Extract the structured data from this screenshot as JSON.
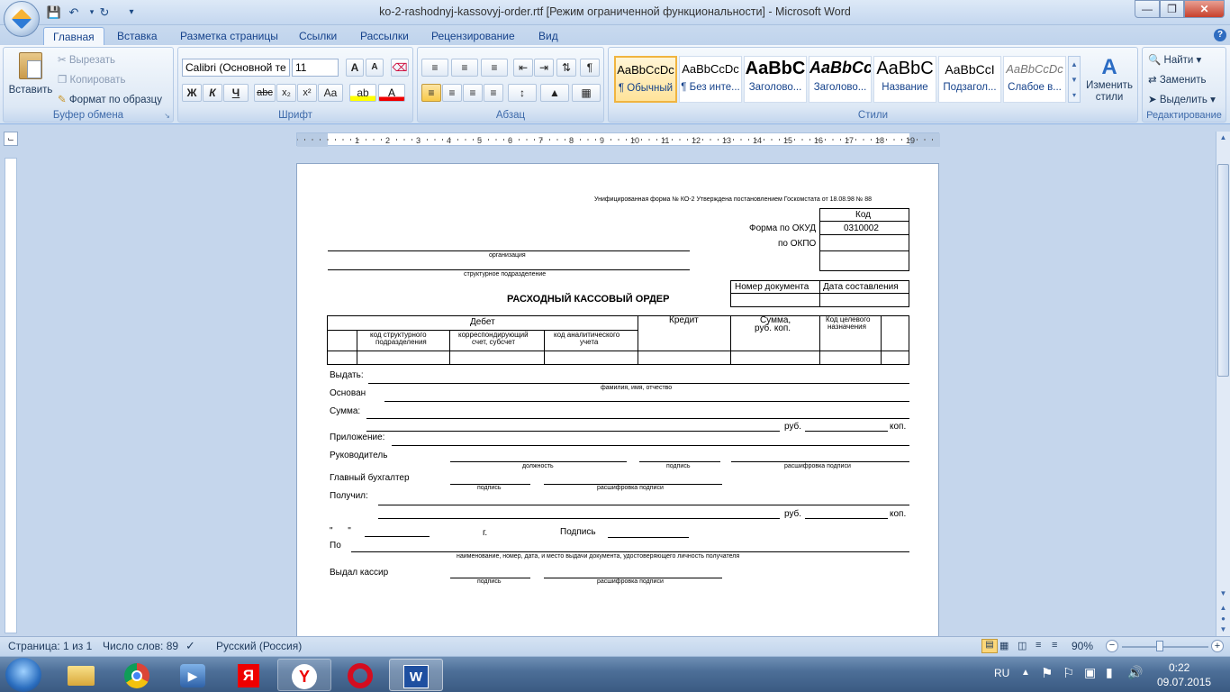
{
  "window": {
    "title": "ko-2-rashodnyj-kassovyj-order.rtf [Режим ограниченной функциональности] - Microsoft Word"
  },
  "tabs": [
    "Главная",
    "Вставка",
    "Разметка страницы",
    "Ссылки",
    "Рассылки",
    "Рецензирование",
    "Вид"
  ],
  "clipboard": {
    "paste": "Вставить",
    "cut": "Вырезать",
    "copy": "Копировать",
    "format_painter": "Формат по образцу",
    "label": "Буфер обмена"
  },
  "font": {
    "name": "Calibri (Основной те",
    "size": "11",
    "label": "Шрифт"
  },
  "paragraph": {
    "label": "Абзац"
  },
  "styles": {
    "label": "Стили",
    "change": "Изменить стили",
    "items": [
      {
        "sample": "AaBbCcDc",
        "name": "¶ Обычный"
      },
      {
        "sample": "AaBbCcDc",
        "name": "¶ Без инте..."
      },
      {
        "sample": "AaBbC",
        "name": "Заголово..."
      },
      {
        "sample": "AaBbCc",
        "name": "Заголово..."
      },
      {
        "sample": "AaBbC",
        "name": "Название"
      },
      {
        "sample": "AaBbCcI",
        "name": "Подзагол..."
      },
      {
        "sample": "AaBbCcDc",
        "name": "Слабое в..."
      }
    ]
  },
  "editing": {
    "find": "Найти",
    "replace": "Заменить",
    "select": "Выделить",
    "label": "Редактирование"
  },
  "document": {
    "header_note": "Унифицированная форма № КО-2 Утверждена постановлением Госкомстата от 18.08.98 № 88",
    "kod": "Код",
    "forma_okud": "Форма по ОКУД",
    "okud_value": "0310002",
    "po_okpo": "по ОКПО",
    "organizaciya": "организация",
    "strukturnoe": "структурное подразделение",
    "nomer_doc": "Номер документа",
    "data_sost": "Дата составления",
    "title": "РАСХОДНЫЙ КАССОВЫЙ ОРДЕР",
    "debet": "Дебет",
    "kod_struct_1": "код структурного",
    "kod_struct_2": "подразделения",
    "korr_1": "корреспондирующий",
    "korr_2": "счет, субсчет",
    "kod_anal_1": "код аналитического",
    "kod_anal_2": "учета",
    "kredit": "Кредит",
    "summa_1": "Сумма,",
    "summa_2": "руб. коп.",
    "kod_cel_1": "Код целевого",
    "kod_cel_2": "назначения",
    "vydat": "Выдать:",
    "fio": "фамилия, имя, отчество",
    "osnovan": "Основан",
    "summa": "Сумма:",
    "rub": "руб.",
    "kop": "коп.",
    "prilozhenie": "Приложение:",
    "rukovoditel": "Руководитель",
    "dolzhnost": "должность",
    "podpis": "подпись",
    "rasshifrovka": "расшифровка подписи",
    "glav_buh": "Главный бухгалтер",
    "poluchil": "Получил:",
    "quote": "\"      \"",
    "g": "г.",
    "podpis_label": "Подпись",
    "po": "По",
    "naim": "наименование, номер, дата, и место выдачи документа, удостоверяющего личность получателя",
    "vydal": "Выдал кассир"
  },
  "status": {
    "page": "Страница: 1 из 1",
    "words": "Число слов: 89",
    "language": "Русский (Россия)",
    "zoom": "90%"
  },
  "tray": {
    "lang": "RU",
    "time": "0:22",
    "date": "09.07.2015"
  }
}
